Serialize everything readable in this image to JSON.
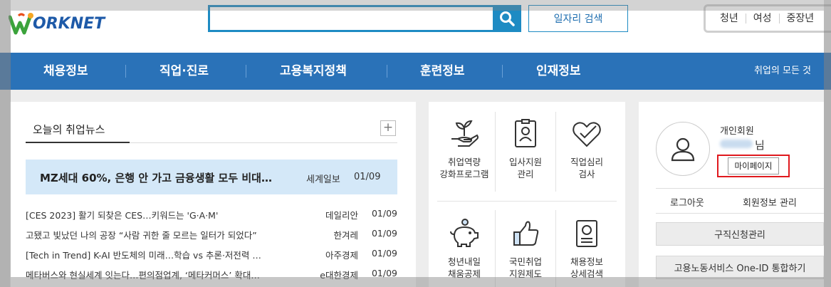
{
  "header": {
    "logo_text": "ORKNET",
    "search_placeholder": "",
    "job_search_label": "일자리 검색",
    "quick_links": [
      "청년",
      "여성",
      "중장년"
    ]
  },
  "nav": {
    "items": [
      "채용정보",
      "직업·진로",
      "고용복지정책",
      "훈련정보",
      "인재정보"
    ],
    "all_label": "취업의 모든 것"
  },
  "news": {
    "title": "오늘의 취업뉴스",
    "more_label": "+",
    "headline": {
      "title": "MZ세대 60%, 은행 안 가고 금융생활 모두 비대…",
      "source": "세계일보",
      "date": "01/09"
    },
    "items": [
      {
        "title": "[CES 2023] 활기 되찾은 CES…키워드는 'G·A·M'",
        "source": "데일리안",
        "date": "01/09"
      },
      {
        "title": "고됐고 빛났던 나의 공장 “사람 귀한 줄 모르는 일터가 되었다”",
        "source": "한겨레",
        "date": "01/09"
      },
      {
        "title": "[Tech in Trend] K-AI 반도체의 미래…학습 vs 추론·저전력 …",
        "source": "아주경제",
        "date": "01/09"
      },
      {
        "title": "메타버스와 현실세계 잇는다…편의점업계, ‘메타커머스’ 확대…",
        "source": "e대한경제",
        "date": "01/09"
      }
    ]
  },
  "services": [
    {
      "icon": "sprout-hand-icon",
      "label": "취업역량\n강화프로그램"
    },
    {
      "icon": "id-card-icon",
      "label": "입사지원\n관리"
    },
    {
      "icon": "heart-check-icon",
      "label": "직업심리\n검사"
    },
    {
      "icon": "piggy-bank-icon",
      "label": "청년내일\n채움공제"
    },
    {
      "icon": "thumbs-up-icon",
      "label": "국민취업\n지원제도"
    },
    {
      "icon": "document-detail-icon",
      "label": "채용정보\n상세검색"
    }
  ],
  "member": {
    "type": "개인회원",
    "suffix": "님",
    "mypage_label": "마이페이지",
    "logout_label": "로그아웃",
    "info_label": "회원정보 관리",
    "job_request_label": "구직신청관리",
    "one_id_label": "고용노동서비스 One-ID 통합하기"
  },
  "colors": {
    "brand_blue": "#2a72b8",
    "search_blue": "#1e8bc3",
    "headline_bg": "#d4e8f8",
    "highlight_red": "#e0191e"
  }
}
